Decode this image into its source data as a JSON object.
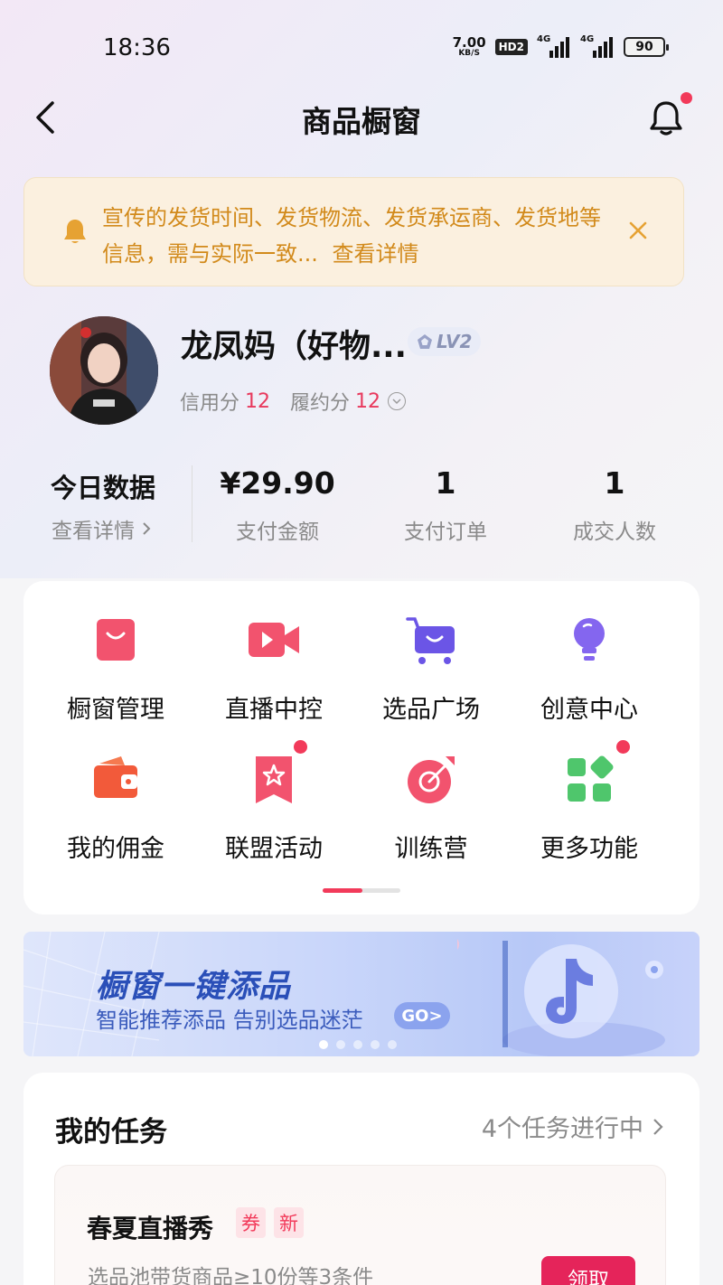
{
  "status_bar": {
    "time": "18:36",
    "net_speed_value": "7.00",
    "net_speed_unit": "KB/S",
    "hd_badge": "HD2",
    "signal1_label": "4G",
    "signal2_label": "4G",
    "battery": "90"
  },
  "nav": {
    "title": "商品橱窗",
    "icons": [
      "back-icon",
      "bell-icon"
    ]
  },
  "notice": {
    "text": "宣传的发货时间、发货物流、发货承运商、发货地等信息，需与实际一致...",
    "link": "查看详情",
    "color": "#d28a1b"
  },
  "profile": {
    "name": "龙凤妈（好物...",
    "level": "LV2",
    "credit_label": "信用分",
    "credit_value": "12",
    "fulfill_label": "履约分",
    "fulfill_value": "12"
  },
  "stats": {
    "heading": "今日数据",
    "details_link": "查看详情",
    "items": [
      {
        "value": "¥29.90",
        "label": "支付金额"
      },
      {
        "value": "1",
        "label": "支付订单"
      },
      {
        "value": "1",
        "label": "成交人数"
      }
    ]
  },
  "grid": {
    "items": [
      {
        "label": "橱窗管理",
        "icon": "shopping-bag-icon"
      },
      {
        "label": "直播中控",
        "icon": "video-camera-icon"
      },
      {
        "label": "选品广场",
        "icon": "shopping-cart-icon"
      },
      {
        "label": "创意中心",
        "icon": "lightbulb-icon"
      },
      {
        "label": "我的佣金",
        "icon": "wallet-icon"
      },
      {
        "label": "联盟活动",
        "icon": "star-ribbon-icon"
      },
      {
        "label": "训练营",
        "icon": "target-icon"
      },
      {
        "label": "更多功能",
        "icon": "apps-grid-icon"
      }
    ],
    "accent": "#f23a5a"
  },
  "banner": {
    "title": "橱窗一键添品",
    "subtitle": "智能推荐添品 告别选品迷茫",
    "go_label": "GO>",
    "page_count": 5,
    "active_page": 1
  },
  "tasks": {
    "title": "我的任务",
    "count_text": "4个任务进行中",
    "items": [
      {
        "name": "春夏直播秀",
        "tags": [
          "券",
          "新"
        ],
        "desc": "选品池带货商品≥10份等3条件",
        "button": "领取"
      }
    ]
  }
}
